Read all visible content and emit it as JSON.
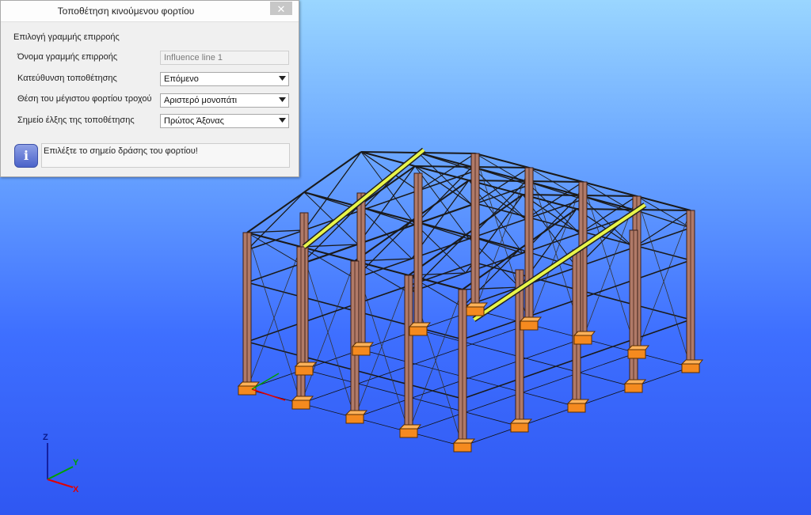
{
  "dialog": {
    "title": "Τοποθέτηση κινούμενου φορτίου",
    "close_icon": "close-icon",
    "group_label": "Επιλογή γραμμής επιρροής",
    "fields": [
      {
        "label": "Όνομα γραμμής επιρροής",
        "value": "Influence line 1",
        "readonly": true
      },
      {
        "label": "Κατεύθυνση τοποθέτησης",
        "value": "Επόμενο"
      },
      {
        "label": "Θέση του μέγιστου φορτίου τροχού",
        "value": "Αριστερό μονοπάτι"
      },
      {
        "label": "Σημείο έλξης της τοποθέτησης",
        "value": "Πρώτος Άξονας"
      }
    ],
    "info_icon": "info-icon",
    "info_message": "Επιλέξτε το σημείο δράσης του φορτίου!"
  },
  "axes": {
    "z": "Z",
    "y": "Y",
    "x": "X"
  },
  "colors": {
    "column": "#b07a68",
    "member": "#1a1a1a",
    "base_plate": "#f58a1f",
    "crane_rail": "#e8f54a",
    "background_top": "#9ad6ff",
    "background_bottom": "#2f57f2"
  }
}
